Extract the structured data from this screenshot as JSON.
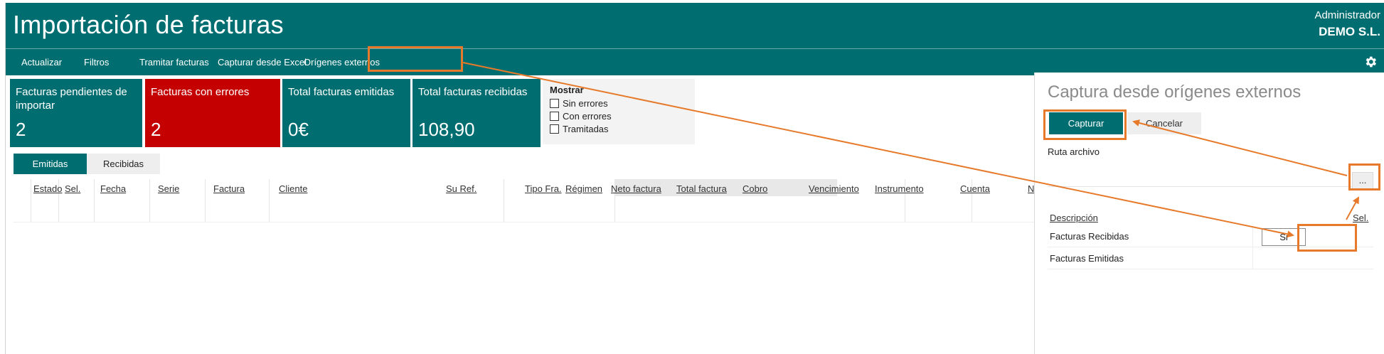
{
  "header": {
    "title": "Importación de facturas",
    "user_role": "Administrador",
    "company": "DEMO S.L."
  },
  "toolbar": {
    "items": [
      "Actualizar",
      "Filtros",
      "Tramitar facturas",
      "Capturar desde Excel",
      "Orígenes externos"
    ],
    "settings_icon": "gear-icon"
  },
  "tiles": [
    {
      "label": "Facturas pendientes de importar",
      "value": "2"
    },
    {
      "label": "Facturas con errores",
      "value": "2"
    },
    {
      "label": "Total facturas emitidas",
      "value": "0€"
    },
    {
      "label": "Total facturas recibidas",
      "value": "108,90"
    }
  ],
  "mostrar": {
    "title": "Mostrar",
    "options": [
      "Sin errores",
      "Con errores",
      "Tramitadas"
    ]
  },
  "tabs": [
    "Emitidas",
    "Recibidas"
  ],
  "grid": {
    "columns": [
      "Estado",
      "Sel.",
      "Fecha",
      "Serie",
      "Factura",
      "Cliente",
      "Su Ref.",
      "Tipo Fra.",
      "Régimen",
      "Neto factura",
      "Total factura",
      "Cobro",
      "Vencimiento",
      "Instrumento",
      "Cuenta",
      "No"
    ]
  },
  "panel": {
    "title": "Captura desde orígenes externos",
    "capture_label": "Capturar",
    "cancel_label": "Cancelar",
    "path_label": "Ruta archivo",
    "browse_label": "...",
    "col_description": "Descripción",
    "col_sel": "Sel.",
    "rows": [
      {
        "description": "Facturas Recibidas",
        "sel": "Si"
      },
      {
        "description": "Facturas Emitidas",
        "sel": ""
      }
    ]
  },
  "colors": {
    "brand": "#006e71",
    "error": "#c40000",
    "annotation": "#e67a2a"
  }
}
